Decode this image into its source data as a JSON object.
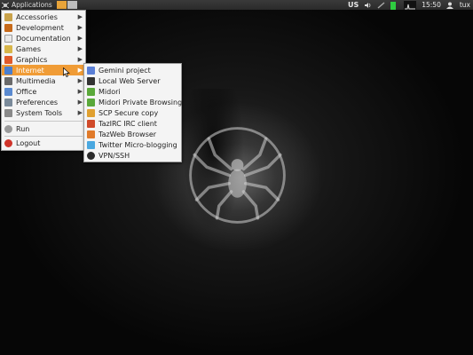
{
  "panel": {
    "applications_label": "Applications",
    "keyboard_layout": "US",
    "clock": "15:50",
    "user": "tux"
  },
  "app_menu": {
    "items": [
      {
        "label": "Accessories",
        "icon": "accessories-icon",
        "color": "#c9a24a"
      },
      {
        "label": "Development",
        "icon": "development-icon",
        "color": "#c76a1a"
      },
      {
        "label": "Documentation",
        "icon": "documentation-icon",
        "color": "#e8e8e8"
      },
      {
        "label": "Games",
        "icon": "games-icon",
        "color": "#d8b64a"
      },
      {
        "label": "Graphics",
        "icon": "graphics-icon",
        "color": "#e05a2a"
      },
      {
        "label": "Internet",
        "icon": "internet-icon",
        "color": "#4a7fd0"
      },
      {
        "label": "Multimedia",
        "icon": "multimedia-icon",
        "color": "#6a6a6a"
      },
      {
        "label": "Office",
        "icon": "office-icon",
        "color": "#5a8ad0"
      },
      {
        "label": "Preferences",
        "icon": "preferences-icon",
        "color": "#7a8a9a"
      },
      {
        "label": "System Tools",
        "icon": "system-tools-icon",
        "color": "#8a8a8a"
      }
    ],
    "run_label": "Run",
    "logout_label": "Logout"
  },
  "internet_menu": {
    "items": [
      {
        "label": "Gemini project",
        "icon": "gemini-icon",
        "color": "#5a7fd6"
      },
      {
        "label": "Local Web Server",
        "icon": "web-server-icon",
        "color": "#333333"
      },
      {
        "label": "Midori",
        "icon": "midori-icon",
        "color": "#5aa83a"
      },
      {
        "label": "Midori Private Browsing",
        "icon": "midori-private-icon",
        "color": "#5aa83a"
      },
      {
        "label": "SCP Secure copy",
        "icon": "scp-icon",
        "color": "#e0a030"
      },
      {
        "label": "TazIRC IRC client",
        "icon": "irc-icon",
        "color": "#d04a2a"
      },
      {
        "label": "TazWeb Browser",
        "icon": "tazweb-icon",
        "color": "#e07a2a"
      },
      {
        "label": "Twitter Micro-blogging",
        "icon": "twitter-icon",
        "color": "#4aa8e0"
      },
      {
        "label": "VPN/SSH",
        "icon": "vpn-icon",
        "color": "#2a2a2a"
      }
    ]
  },
  "colors": {
    "highlight": "#f09c36",
    "panel": "#2f2f2f",
    "menu_bg": "#f4f4f4"
  }
}
